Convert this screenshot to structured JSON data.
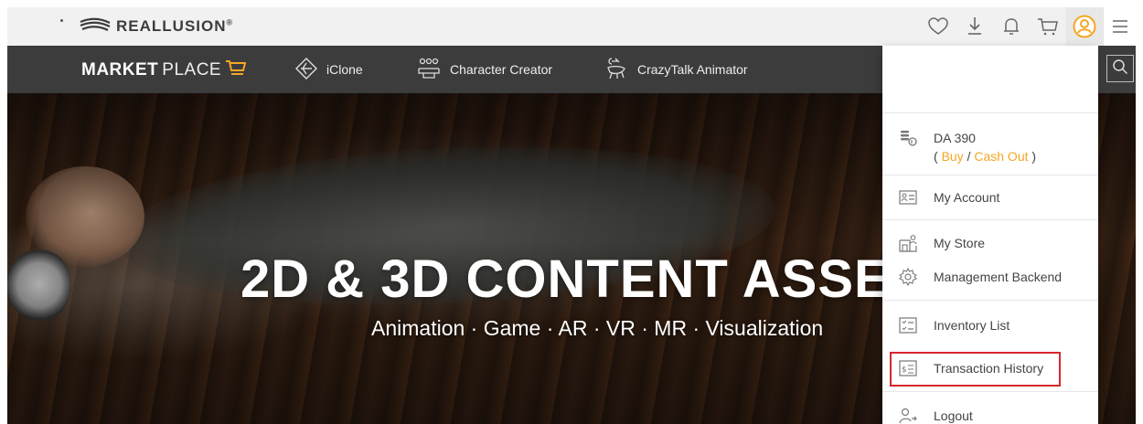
{
  "topbar": {
    "brand": "REALLUSION",
    "brand_mark": "®",
    "icons": [
      "heart-icon",
      "download-icon",
      "bell-icon",
      "cart-icon",
      "user-icon",
      "hamburger-menu-icon"
    ]
  },
  "navbar": {
    "brand_bold": "MARKET",
    "brand_light": "PLACE",
    "items": [
      {
        "label": "iClone",
        "icon": "iclone-icon"
      },
      {
        "label": "Character Creator",
        "icon": "character-creator-icon"
      },
      {
        "label": "CrazyTalk Animator",
        "icon": "crazytalk-animator-icon"
      }
    ]
  },
  "hero": {
    "title": "2D & 3D CONTENT ASSE",
    "subtitle": "Animation · Game · AR · VR · MR · Visualization"
  },
  "dropdown": {
    "da": {
      "balance": "DA 390",
      "open_paren": "( ",
      "buy": "Buy",
      "slash": " / ",
      "cash_out": "Cash Out",
      "close_paren": " )"
    },
    "items": {
      "my_account": "My Account",
      "my_store": "My Store",
      "management_backend": "Management Backend",
      "inventory_list": "Inventory List",
      "transaction_history": "Transaction History",
      "logout": "Logout"
    }
  },
  "colors": {
    "accent": "#f5a623",
    "highlight": "#d7262d",
    "navbar_bg": "#3c3c3c",
    "topbar_bg": "#f1f1f1"
  }
}
